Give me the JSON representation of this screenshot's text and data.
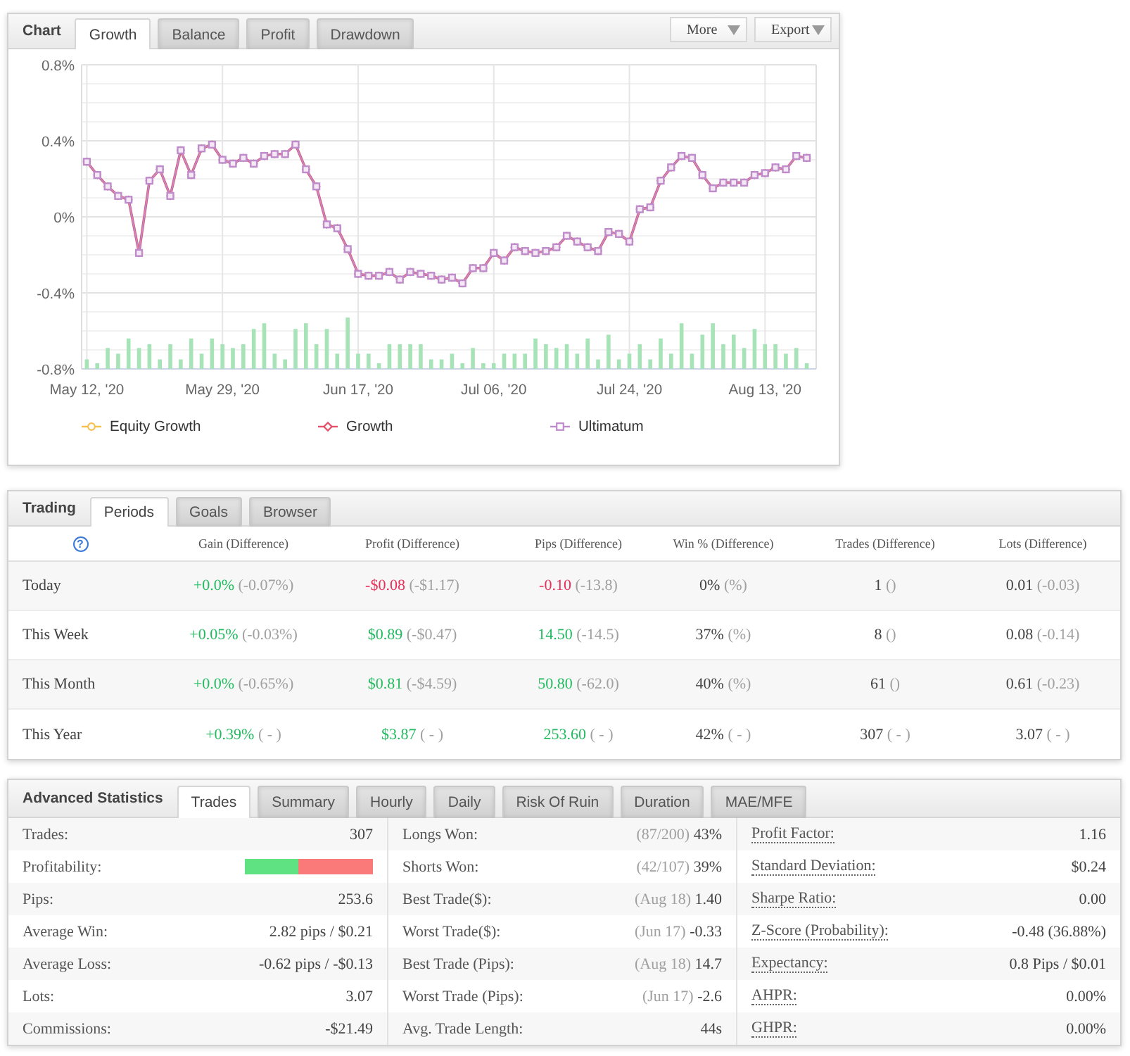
{
  "chart": {
    "title": "Chart",
    "tabs": [
      {
        "label": "Growth",
        "selected": true
      },
      {
        "label": "Balance",
        "selected": false
      },
      {
        "label": "Profit",
        "selected": false
      },
      {
        "label": "Drawdown",
        "selected": false
      }
    ],
    "buttons": [
      "More",
      "Export"
    ],
    "chart_data": {
      "type": "line",
      "grid": true,
      "categories": [
        "May 12, '20",
        null,
        null,
        null,
        null,
        null,
        null,
        null,
        null,
        null,
        null,
        null,
        null,
        "May 29, '20",
        null,
        null,
        null,
        null,
        null,
        null,
        null,
        null,
        null,
        null,
        null,
        null,
        "Jun 17, '20",
        null,
        null,
        null,
        null,
        null,
        null,
        null,
        null,
        null,
        null,
        null,
        null,
        "Jul 06, '20",
        null,
        null,
        null,
        null,
        null,
        null,
        null,
        null,
        null,
        null,
        null,
        null,
        "Jul 24, '20",
        null,
        null,
        null,
        null,
        null,
        null,
        null,
        null,
        null,
        null,
        null,
        null,
        "Aug 13, '20",
        null,
        null,
        null,
        null
      ],
      "ylim": [
        -0.8,
        0.8
      ],
      "yticks": [
        {
          "value": -0.8,
          "label": "-0.8%"
        },
        {
          "value": -0.4,
          "label": "-0.4%"
        },
        {
          "value": 0,
          "label": "0%"
        },
        {
          "value": 0.4,
          "label": "0.4%"
        },
        {
          "value": 0.8,
          "label": "0.8%"
        }
      ],
      "series": [
        {
          "name": "Equity Growth",
          "color": "#f5c04e",
          "marker": "circle",
          "values": [
            null,
            null,
            null,
            null,
            null,
            null,
            null,
            null,
            null,
            null,
            null,
            null,
            null,
            null,
            null,
            null,
            null,
            null,
            null,
            null,
            null,
            null,
            null,
            null,
            null,
            null,
            null,
            null,
            null,
            null,
            null,
            null,
            null,
            null,
            null,
            null,
            null,
            null,
            null,
            null,
            null,
            null,
            null,
            null,
            null,
            null,
            null,
            null,
            null,
            null,
            null,
            null,
            null,
            null,
            null,
            null,
            null,
            null,
            null,
            null,
            null,
            null,
            null,
            null,
            null,
            null,
            null,
            null,
            null,
            null
          ]
        },
        {
          "name": "Growth",
          "color": "#e4506a",
          "marker": "diamond",
          "values": [
            0.29,
            0.22,
            0.16,
            0.11,
            0.09,
            -0.19,
            0.19,
            0.25,
            0.11,
            0.35,
            0.22,
            0.36,
            0.38,
            0.3,
            0.28,
            0.31,
            0.28,
            0.32,
            0.33,
            0.33,
            0.38,
            0.25,
            0.16,
            -0.04,
            -0.06,
            -0.17,
            -0.3,
            -0.31,
            -0.31,
            -0.29,
            -0.33,
            -0.29,
            -0.3,
            -0.31,
            -0.33,
            -0.32,
            -0.35,
            -0.27,
            -0.27,
            -0.19,
            -0.23,
            -0.16,
            -0.18,
            -0.19,
            -0.18,
            -0.16,
            -0.1,
            -0.13,
            -0.16,
            -0.18,
            -0.08,
            -0.09,
            -0.13,
            0.04,
            0.05,
            0.19,
            0.26,
            0.32,
            0.31,
            0.22,
            0.15,
            0.18,
            0.18,
            0.18,
            0.22,
            0.23,
            0.26,
            0.25,
            0.32,
            0.31
          ]
        },
        {
          "name": "Ultimatum",
          "color": "#bf8ccb",
          "marker": "square",
          "values": [
            0.29,
            0.22,
            0.16,
            0.11,
            0.09,
            -0.19,
            0.19,
            0.25,
            0.11,
            0.35,
            0.22,
            0.36,
            0.38,
            0.3,
            0.28,
            0.31,
            0.28,
            0.32,
            0.33,
            0.33,
            0.38,
            0.25,
            0.16,
            -0.04,
            -0.06,
            -0.17,
            -0.3,
            -0.31,
            -0.31,
            -0.29,
            -0.33,
            -0.29,
            -0.3,
            -0.31,
            -0.33,
            -0.32,
            -0.35,
            -0.27,
            -0.27,
            -0.19,
            -0.23,
            -0.16,
            -0.18,
            -0.19,
            -0.18,
            -0.16,
            -0.1,
            -0.13,
            -0.16,
            -0.18,
            -0.08,
            -0.09,
            -0.13,
            0.04,
            0.05,
            0.19,
            0.26,
            0.32,
            0.31,
            0.22,
            0.15,
            0.18,
            0.18,
            0.18,
            0.22,
            0.23,
            0.26,
            0.25,
            0.32,
            0.31
          ]
        }
      ]
    }
  },
  "trading": {
    "title": "Trading",
    "tabs": [
      {
        "label": "Periods",
        "selected": true
      },
      {
        "label": "Goals",
        "selected": false
      },
      {
        "label": "Browser",
        "selected": false
      }
    ],
    "help": "?",
    "columns": [
      "Gain (Difference)",
      "Profit (Difference)",
      "Pips (Difference)",
      "Win % (Difference)",
      "Trades (Difference)",
      "Lots (Difference)"
    ],
    "rows": [
      {
        "period": "Today",
        "cells": [
          {
            "value": "+0.0%",
            "diff": "(-0.07%)",
            "color": "#22bb5f"
          },
          {
            "value": "-$0.08",
            "diff": "(-$1.17)",
            "color": "#e8305a"
          },
          {
            "value": "-0.10",
            "diff": "(-13.8)",
            "color": "#e8305a"
          },
          {
            "value": "0%",
            "diff": "(%)",
            "color": "#444444"
          },
          {
            "value": "1",
            "diff": "()",
            "color": "#444444"
          },
          {
            "value": "0.01",
            "diff": "(-0.03)",
            "color": "#444444"
          }
        ]
      },
      {
        "period": "This Week",
        "cells": [
          {
            "value": "+0.05%",
            "diff": "(-0.03%)",
            "color": "#22bb5f"
          },
          {
            "value": "$0.89",
            "diff": "(-$0.47)",
            "color": "#22bb5f"
          },
          {
            "value": "14.50",
            "diff": "(-14.5)",
            "color": "#22bb5f"
          },
          {
            "value": "37%",
            "diff": "(%)",
            "color": "#444444"
          },
          {
            "value": "8",
            "diff": "()",
            "color": "#444444"
          },
          {
            "value": "0.08",
            "diff": "(-0.14)",
            "color": "#444444"
          }
        ]
      },
      {
        "period": "This Month",
        "cells": [
          {
            "value": "+0.0%",
            "diff": "(-0.65%)",
            "color": "#22bb5f"
          },
          {
            "value": "$0.81",
            "diff": "(-$4.59)",
            "color": "#22bb5f"
          },
          {
            "value": "50.80",
            "diff": "(-62.0)",
            "color": "#22bb5f"
          },
          {
            "value": "40%",
            "diff": "(%)",
            "color": "#444444"
          },
          {
            "value": "61",
            "diff": "()",
            "color": "#444444"
          },
          {
            "value": "0.61",
            "diff": "(-0.23)",
            "color": "#444444"
          }
        ]
      },
      {
        "period": "This Year",
        "cells": [
          {
            "value": "+0.39%",
            "diff": "( - )",
            "color": "#22bb5f"
          },
          {
            "value": "$3.87",
            "diff": "( - )",
            "color": "#22bb5f"
          },
          {
            "value": "253.60",
            "diff": "( - )",
            "color": "#22bb5f"
          },
          {
            "value": "42%",
            "diff": "( - )",
            "color": "#444444"
          },
          {
            "value": "307",
            "diff": "( - )",
            "color": "#444444"
          },
          {
            "value": "3.07",
            "diff": "( - )",
            "color": "#444444"
          }
        ]
      }
    ]
  },
  "advanced_statistics": {
    "title": "Advanced Statistics",
    "tabs": [
      {
        "label": "Trades",
        "selected": true
      },
      {
        "label": "Summary",
        "selected": false
      },
      {
        "label": "Hourly",
        "selected": false
      },
      {
        "label": "Daily",
        "selected": false
      },
      {
        "label": "Risk Of Ruin",
        "selected": false
      },
      {
        "label": "Duration",
        "selected": false
      },
      {
        "label": "MAE/MFE",
        "selected": false
      }
    ],
    "columns": [
      {
        "rows": [
          {
            "label": "Trades:",
            "kind": "text",
            "value": "307"
          },
          {
            "label": "Profitability:",
            "kind": "bar",
            "level": 0.42
          },
          {
            "label": "Pips:",
            "kind": "text",
            "value": "253.6"
          },
          {
            "label": "Average Win:",
            "kind": "text",
            "value": "2.82 pips / $0.21"
          },
          {
            "label": "Average Loss:",
            "kind": "text",
            "value": "-0.62 pips / -$0.13"
          },
          {
            "label": "Lots:",
            "kind": "text",
            "value": "3.07"
          },
          {
            "label": "Commissions:",
            "kind": "text",
            "value": "-$21.49"
          }
        ]
      },
      {
        "rows": [
          {
            "label": "Longs Won:",
            "kind": "text",
            "note": "(87/200)",
            "value": "43%"
          },
          {
            "label": "Shorts Won:",
            "kind": "text",
            "note": "(42/107)",
            "value": "39%"
          },
          {
            "label": "Best Trade($):",
            "kind": "text",
            "note": "(Aug 18)",
            "value": "1.40"
          },
          {
            "label": "Worst Trade($):",
            "kind": "text",
            "note": "(Jun 17)",
            "value": "-0.33"
          },
          {
            "label": "Best Trade (Pips):",
            "kind": "text",
            "note": "(Aug 18)",
            "value": "14.7"
          },
          {
            "label": "Worst Trade (Pips):",
            "kind": "text",
            "note": "(Jun 17)",
            "value": "-2.6"
          },
          {
            "label": "Avg. Trade Length:",
            "kind": "text",
            "value": "44s"
          }
        ]
      },
      {
        "rows": [
          {
            "label": "Profit Factor:",
            "kind": "term",
            "value": "1.16"
          },
          {
            "label": "Standard Deviation:",
            "kind": "term",
            "value": "$0.24"
          },
          {
            "label": "Sharpe Ratio:",
            "kind": "term",
            "value": "0.00"
          },
          {
            "label": "Z-Score (Probability):",
            "kind": "term",
            "value": "-0.48 (36.88%)"
          },
          {
            "label": "Expectancy:",
            "kind": "term",
            "value": "0.8 Pips / $0.01"
          },
          {
            "label": "AHPR:",
            "kind": "term",
            "value": "0.00%"
          },
          {
            "label": "GHPR:",
            "kind": "term",
            "value": "0.00%"
          }
        ]
      }
    ]
  }
}
